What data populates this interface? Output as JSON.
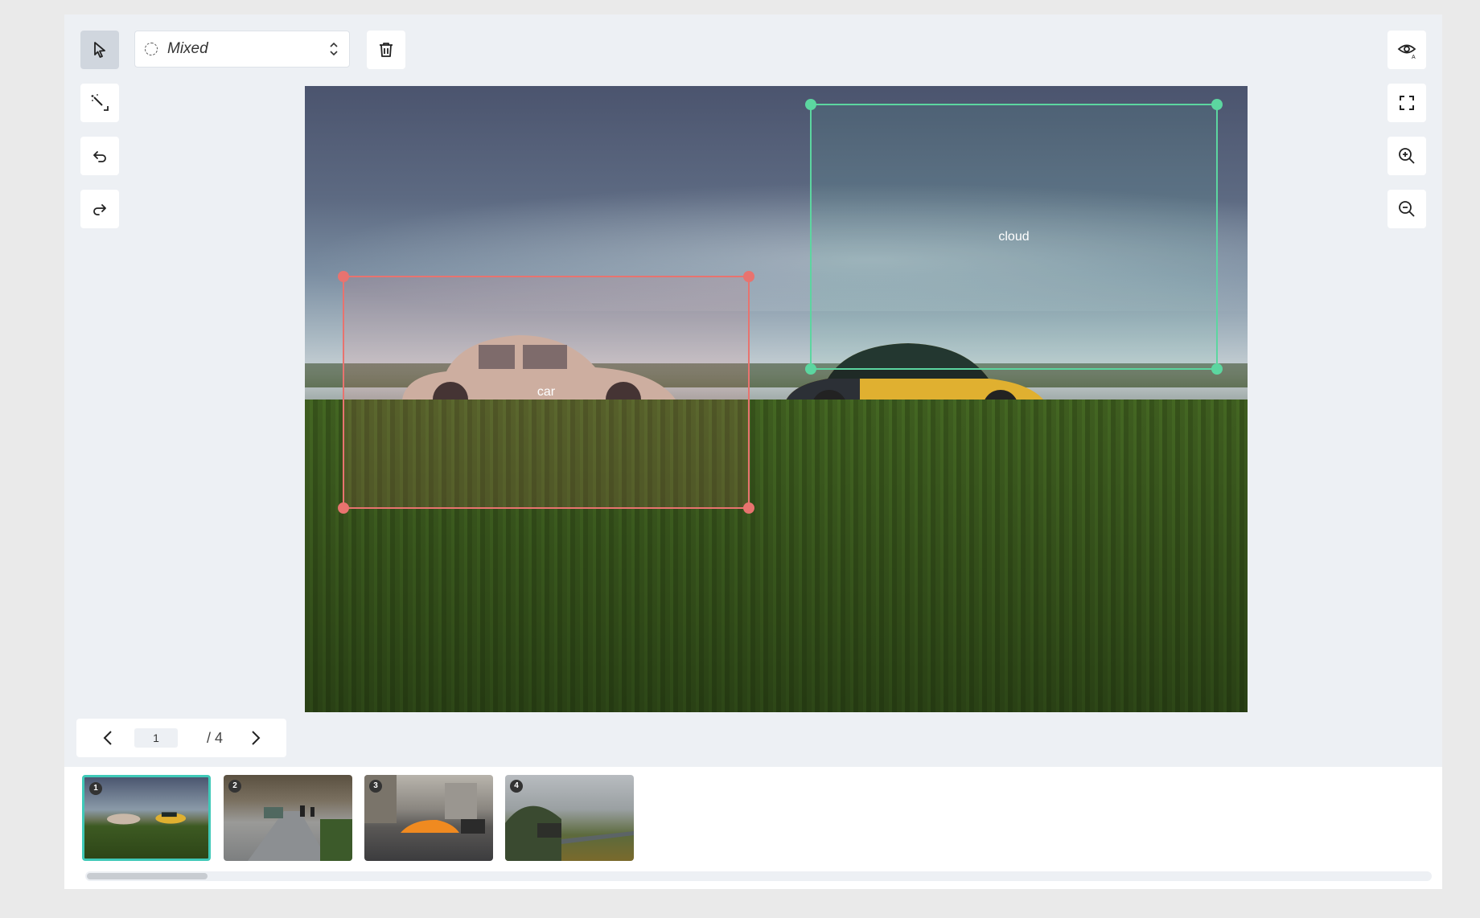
{
  "toolbar": {
    "shape_select": {
      "value": "Mixed",
      "icon": "dashed-circle-icon"
    },
    "tools_left": [
      "pointer-icon",
      "magic-wand-icon",
      "undo-icon",
      "redo-icon"
    ],
    "delete_icon": "trash-icon",
    "tools_right": [
      "eye-annotation-icon",
      "fullscreen-icon",
      "zoom-in-icon",
      "zoom-out-icon"
    ]
  },
  "annotations": [
    {
      "label": "car",
      "color": "#e8736f"
    },
    {
      "label": "cloud",
      "color": "#5cd6a0"
    }
  ],
  "pager": {
    "current": "1",
    "total": "/ 4"
  },
  "thumbnails": [
    {
      "num": "1",
      "active": true
    },
    {
      "num": "2",
      "active": false
    },
    {
      "num": "3",
      "active": false
    },
    {
      "num": "4",
      "active": false
    }
  ],
  "colors": {
    "accent": "#3fc9b8",
    "background": "#edf0f4"
  }
}
